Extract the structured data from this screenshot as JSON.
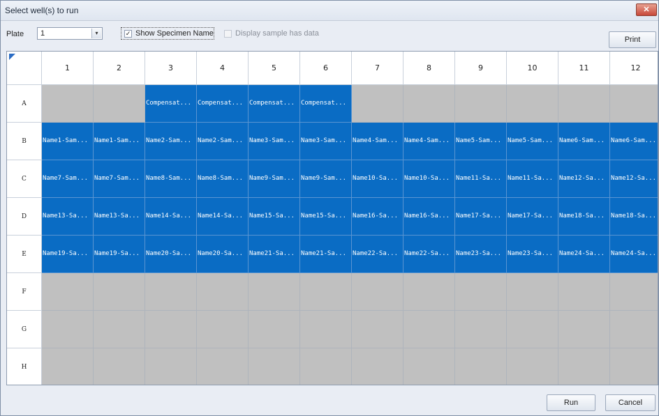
{
  "window": {
    "title": "Select well(s) to run",
    "close_label": "✕"
  },
  "toolbar": {
    "plate_label": "Plate",
    "plate_value": "1",
    "show_specimen_label": "Show Specimen Name",
    "show_specimen_checked": true,
    "display_sample_label": "Display sample has data",
    "display_sample_checked": false,
    "print_label": "Print"
  },
  "grid": {
    "columns": [
      "1",
      "2",
      "3",
      "4",
      "5",
      "6",
      "7",
      "8",
      "9",
      "10",
      "11",
      "12"
    ],
    "rows": [
      {
        "label": "A",
        "cells": [
          "",
          "",
          "Compensat...",
          "Compensat...",
          "Compensat...",
          "Compensat...",
          "",
          "",
          "",
          "",
          "",
          ""
        ]
      },
      {
        "label": "B",
        "cells": [
          "Name1-Sam...",
          "Name1-Sam...",
          "Name2-Sam...",
          "Name2-Sam...",
          "Name3-Sam...",
          "Name3-Sam...",
          "Name4-Sam...",
          "Name4-Sam...",
          "Name5-Sam...",
          "Name5-Sam...",
          "Name6-Sam...",
          "Name6-Sam..."
        ]
      },
      {
        "label": "C",
        "cells": [
          "Name7-Sam...",
          "Name7-Sam...",
          "Name8-Sam...",
          "Name8-Sam...",
          "Name9-Sam...",
          "Name9-Sam...",
          "Name10-Sa...",
          "Name10-Sa...",
          "Name11-Sa...",
          "Name11-Sa...",
          "Name12-Sa...",
          "Name12-Sa..."
        ]
      },
      {
        "label": "D",
        "cells": [
          "Name13-Sa...",
          "Name13-Sa...",
          "Name14-Sa...",
          "Name14-Sa...",
          "Name15-Sa...",
          "Name15-Sa...",
          "Name16-Sa...",
          "Name16-Sa...",
          "Name17-Sa...",
          "Name17-Sa...",
          "Name18-Sa...",
          "Name18-Sa..."
        ]
      },
      {
        "label": "E",
        "cells": [
          "Name19-Sa...",
          "Name19-Sa...",
          "Name20-Sa...",
          "Name20-Sa...",
          "Name21-Sa...",
          "Name21-Sa...",
          "Name22-Sa...",
          "Name22-Sa...",
          "Name23-Sa...",
          "Name23-Sa...",
          "Name24-Sa...",
          "Name24-Sa..."
        ]
      },
      {
        "label": "F",
        "cells": [
          "",
          "",
          "",
          "",
          "",
          "",
          "",
          "",
          "",
          "",
          "",
          ""
        ]
      },
      {
        "label": "G",
        "cells": [
          "",
          "",
          "",
          "",
          "",
          "",
          "",
          "",
          "",
          "",
          "",
          ""
        ]
      },
      {
        "label": "H",
        "cells": [
          "",
          "",
          "",
          "",
          "",
          "",
          "",
          "",
          "",
          "",
          "",
          ""
        ]
      }
    ],
    "colors": {
      "selected_well": "#0a6cc4",
      "empty_well": "#c0c0c0"
    }
  },
  "footer": {
    "run_label": "Run",
    "cancel_label": "Cancel"
  }
}
